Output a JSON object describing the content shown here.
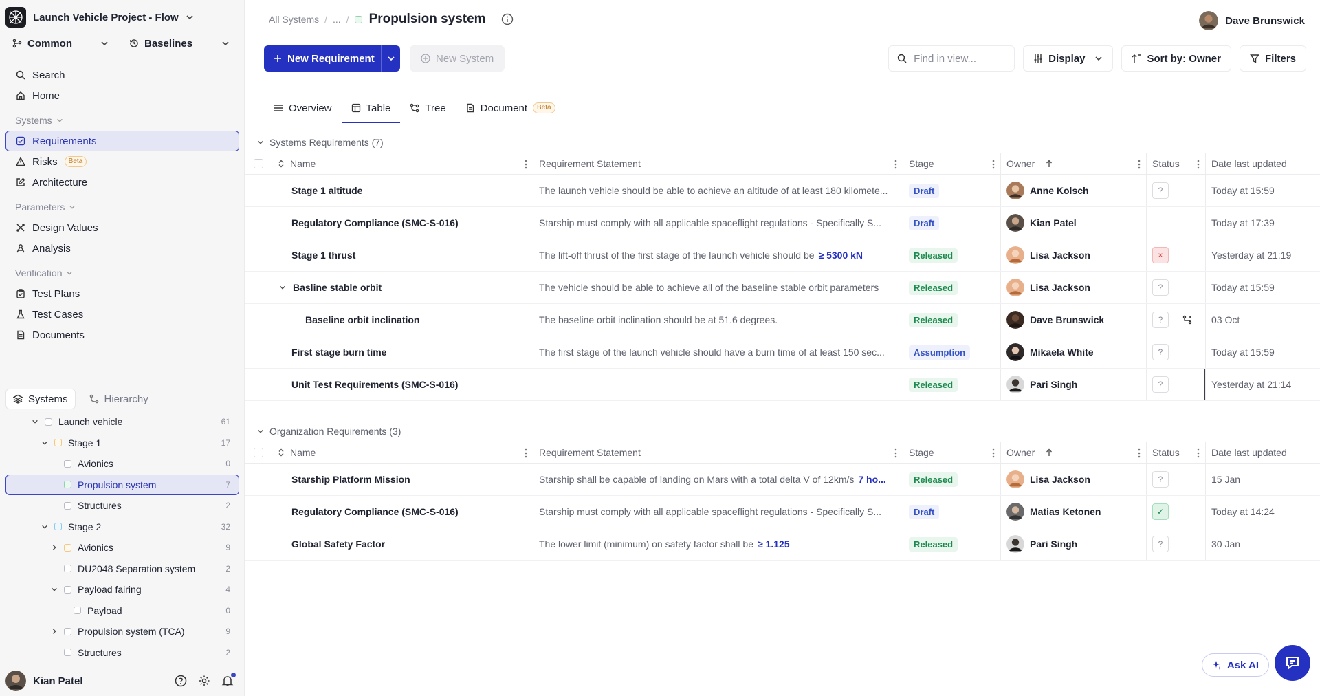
{
  "sidebar": {
    "project": "Launch Vehicle Project - Flow",
    "dropdowns": {
      "common": "Common",
      "baselines": "Baselines"
    },
    "top_items": {
      "search": "Search",
      "home": "Home"
    },
    "systems_section": "Systems",
    "systems_items": {
      "requirements": "Requirements",
      "risks": "Risks",
      "architecture": "Architecture"
    },
    "beta": "Beta",
    "parameters_section": "Parameters",
    "parameters_items": {
      "design_values": "Design Values",
      "analysis": "Analysis"
    },
    "verification_section": "Verification",
    "verification_items": {
      "test_plans": "Test Plans",
      "test_cases": "Test Cases",
      "documents": "Documents"
    },
    "tabs": {
      "systems": "Systems",
      "hierarchy": "Hierarchy"
    },
    "tree": [
      {
        "label": "Launch vehicle",
        "count": "61"
      },
      {
        "label": "Stage 1",
        "count": "17"
      },
      {
        "label": "Avionics",
        "count": "0"
      },
      {
        "label": "Propulsion system",
        "count": "7"
      },
      {
        "label": "Structures",
        "count": "2"
      },
      {
        "label": "Stage 2",
        "count": "32"
      },
      {
        "label": "Avionics",
        "count": "9"
      },
      {
        "label": "DU2048 Separation system",
        "count": "2"
      },
      {
        "label": "Payload fairing",
        "count": "4"
      },
      {
        "label": "Payload",
        "count": "0"
      },
      {
        "label": "Propulsion system (TCA)",
        "count": "9"
      },
      {
        "label": "Structures",
        "count": "2"
      }
    ],
    "user": "Kian Patel"
  },
  "header": {
    "crumb_root": "All Systems",
    "crumb_ellipsis": "...",
    "crumb_sep": "/",
    "title": "Propulsion system",
    "user": "Dave Brunswick"
  },
  "toolbar": {
    "new_requirement": "New Requirement",
    "new_system": "New System",
    "find_placeholder": "Find in view...",
    "display": "Display",
    "sort": "Sort by: Owner",
    "filters": "Filters"
  },
  "view_tabs": {
    "overview": "Overview",
    "table": "Table",
    "tree": "Tree",
    "document": "Document",
    "beta": "Beta"
  },
  "columns": {
    "name": "Name",
    "statement": "Requirement Statement",
    "stage": "Stage",
    "owner": "Owner",
    "status": "Status",
    "date": "Date last updated"
  },
  "groups": {
    "systems": {
      "title": "Systems Requirements (7)",
      "rows": [
        {
          "name": "Stage 1 altitude",
          "statement": "The launch vehicle should be able to achieve an altitude of at least 180 kilomete...",
          "highlight": "",
          "stage": "Draft",
          "owner": "Anne Kolsch",
          "status": "?",
          "date": "Today at 15:59"
        },
        {
          "name": "Regulatory Compliance (SMC-S-016)",
          "statement": "Starship must comply with all applicable spaceflight regulations - Specifically S...",
          "highlight": "",
          "stage": "Draft",
          "owner": "Kian Patel",
          "status": "",
          "date": "Today at 17:39"
        },
        {
          "name": "Stage 1 thrust",
          "statement": "The lift-off thrust of the first stage of the launch vehicle should be",
          "highlight": "≥ 5300 kN",
          "stage": "Released",
          "owner": "Lisa Jackson",
          "status": "×",
          "date": "Yesterday at 21:19"
        },
        {
          "name": "Basline stable orbit",
          "statement": "The vehicle should be able to achieve all of the baseline stable orbit parameters",
          "highlight": "",
          "stage": "Released",
          "owner": "Lisa Jackson",
          "status": "?",
          "date": "Today at 15:59"
        },
        {
          "name": "Baseline orbit inclination",
          "statement": "The baseline orbit inclination should be at 51.6 degrees.",
          "highlight": "",
          "stage": "Released",
          "owner": "Dave Brunswick",
          "status": "?",
          "date": "03 Oct"
        },
        {
          "name": "First stage burn time",
          "statement": "The first stage of the launch vehicle should have a burn time of at least 150 sec...",
          "highlight": "",
          "stage": "Assumption",
          "owner": "Mikaela White",
          "status": "?",
          "date": "Today at 15:59"
        },
        {
          "name": "Unit Test Requirements (SMC-S-016)",
          "statement": "",
          "highlight": "",
          "stage": "Released",
          "owner": "Pari Singh",
          "status": "?",
          "date": "Yesterday at 21:14"
        }
      ]
    },
    "org": {
      "title": "Organization Requirements (3)",
      "rows": [
        {
          "name": "Starship Platform Mission",
          "statement": "Starship shall be capable of landing on Mars with a total delta V of 12km/s",
          "highlight": "7 ho...",
          "stage": "Released",
          "owner": "Lisa Jackson",
          "status": "?",
          "date": "15 Jan"
        },
        {
          "name": "Regulatory Compliance (SMC-S-016)",
          "statement": "Starship must comply with all applicable spaceflight regulations - Specifically S...",
          "highlight": "",
          "stage": "Draft",
          "owner": "Matias Ketonen",
          "status": "✓",
          "date": "Today at 14:24"
        },
        {
          "name": "Global Safety Factor",
          "statement": "The lower limit (minimum) on safety factor shall be",
          "highlight": "≥ 1.125",
          "stage": "Released",
          "owner": "Pari Singh",
          "status": "?",
          "date": "30 Jan"
        }
      ]
    }
  },
  "ask_ai": "Ask AI",
  "colors": {
    "accent": "#2531c0",
    "released": "#1b8a4c",
    "draft": "#3552c4"
  }
}
